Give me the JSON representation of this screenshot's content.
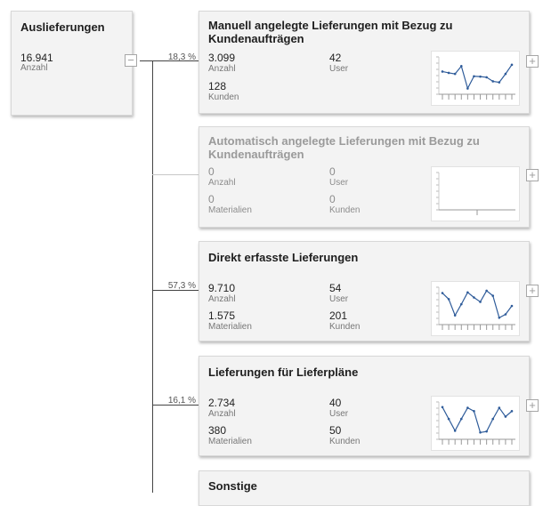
{
  "root": {
    "title": "Auslieferungen",
    "value": "16.941",
    "label": "Anzahl",
    "collapse": "−"
  },
  "branches": [
    {
      "title": "Manuell angelegte Lieferungen mit Bezug zu Kundenaufträgen",
      "percent": "18,3 %",
      "disabled": false,
      "metrics": [
        {
          "value": "3.099",
          "label": "Anzahl"
        },
        {
          "value": "42",
          "label": "User"
        },
        {
          "value": "128",
          "label": "Kunden"
        }
      ],
      "trend": [
        0.62,
        0.58,
        0.55,
        0.78,
        0.12,
        0.48,
        0.47,
        0.45,
        0.33,
        0.3,
        0.55,
        0.82
      ],
      "expand": "+"
    },
    {
      "title": "Automatisch angelegte Lieferungen mit Bezug zu Kundenaufträgen",
      "percent": "",
      "disabled": true,
      "metrics": [
        {
          "value": "0",
          "label": "Anzahl"
        },
        {
          "value": "0",
          "label": "User"
        },
        {
          "value": "0",
          "label": "Materialien"
        },
        {
          "value": "0",
          "label": "Kunden"
        }
      ],
      "trend": [],
      "expand": "+"
    },
    {
      "title": "Direkt erfasste Lieferungen",
      "percent": "57,3 %",
      "disabled": false,
      "metrics": [
        {
          "value": "9.710",
          "label": "Anzahl"
        },
        {
          "value": "54",
          "label": "User"
        },
        {
          "value": "1.575",
          "label": "Materialien"
        },
        {
          "value": "201",
          "label": "Kunden"
        }
      ],
      "trend": [
        0.88,
        0.7,
        0.22,
        0.55,
        0.9,
        0.75,
        0.62,
        0.95,
        0.8,
        0.15,
        0.25,
        0.5
      ],
      "expand": "+"
    },
    {
      "title": "Lieferungen für Lieferpläne",
      "percent": "16,1 %",
      "disabled": false,
      "metrics": [
        {
          "value": "2.734",
          "label": "Anzahl"
        },
        {
          "value": "40",
          "label": "User"
        },
        {
          "value": "380",
          "label": "Materialien"
        },
        {
          "value": "50",
          "label": "Kunden"
        }
      ],
      "trend": [
        0.9,
        0.55,
        0.2,
        0.55,
        0.88,
        0.78,
        0.15,
        0.18,
        0.55,
        0.88,
        0.62,
        0.78
      ],
      "expand": "+"
    },
    {
      "title": "Sonstige",
      "percent": "",
      "disabled": false,
      "metrics": [],
      "trend": [],
      "expand": ""
    }
  ],
  "colors": {
    "trend_line": "#2f5c9a",
    "trend_dot": "#2f5c9a",
    "connector": "#444444",
    "card_bg": "#f3f3f3"
  }
}
